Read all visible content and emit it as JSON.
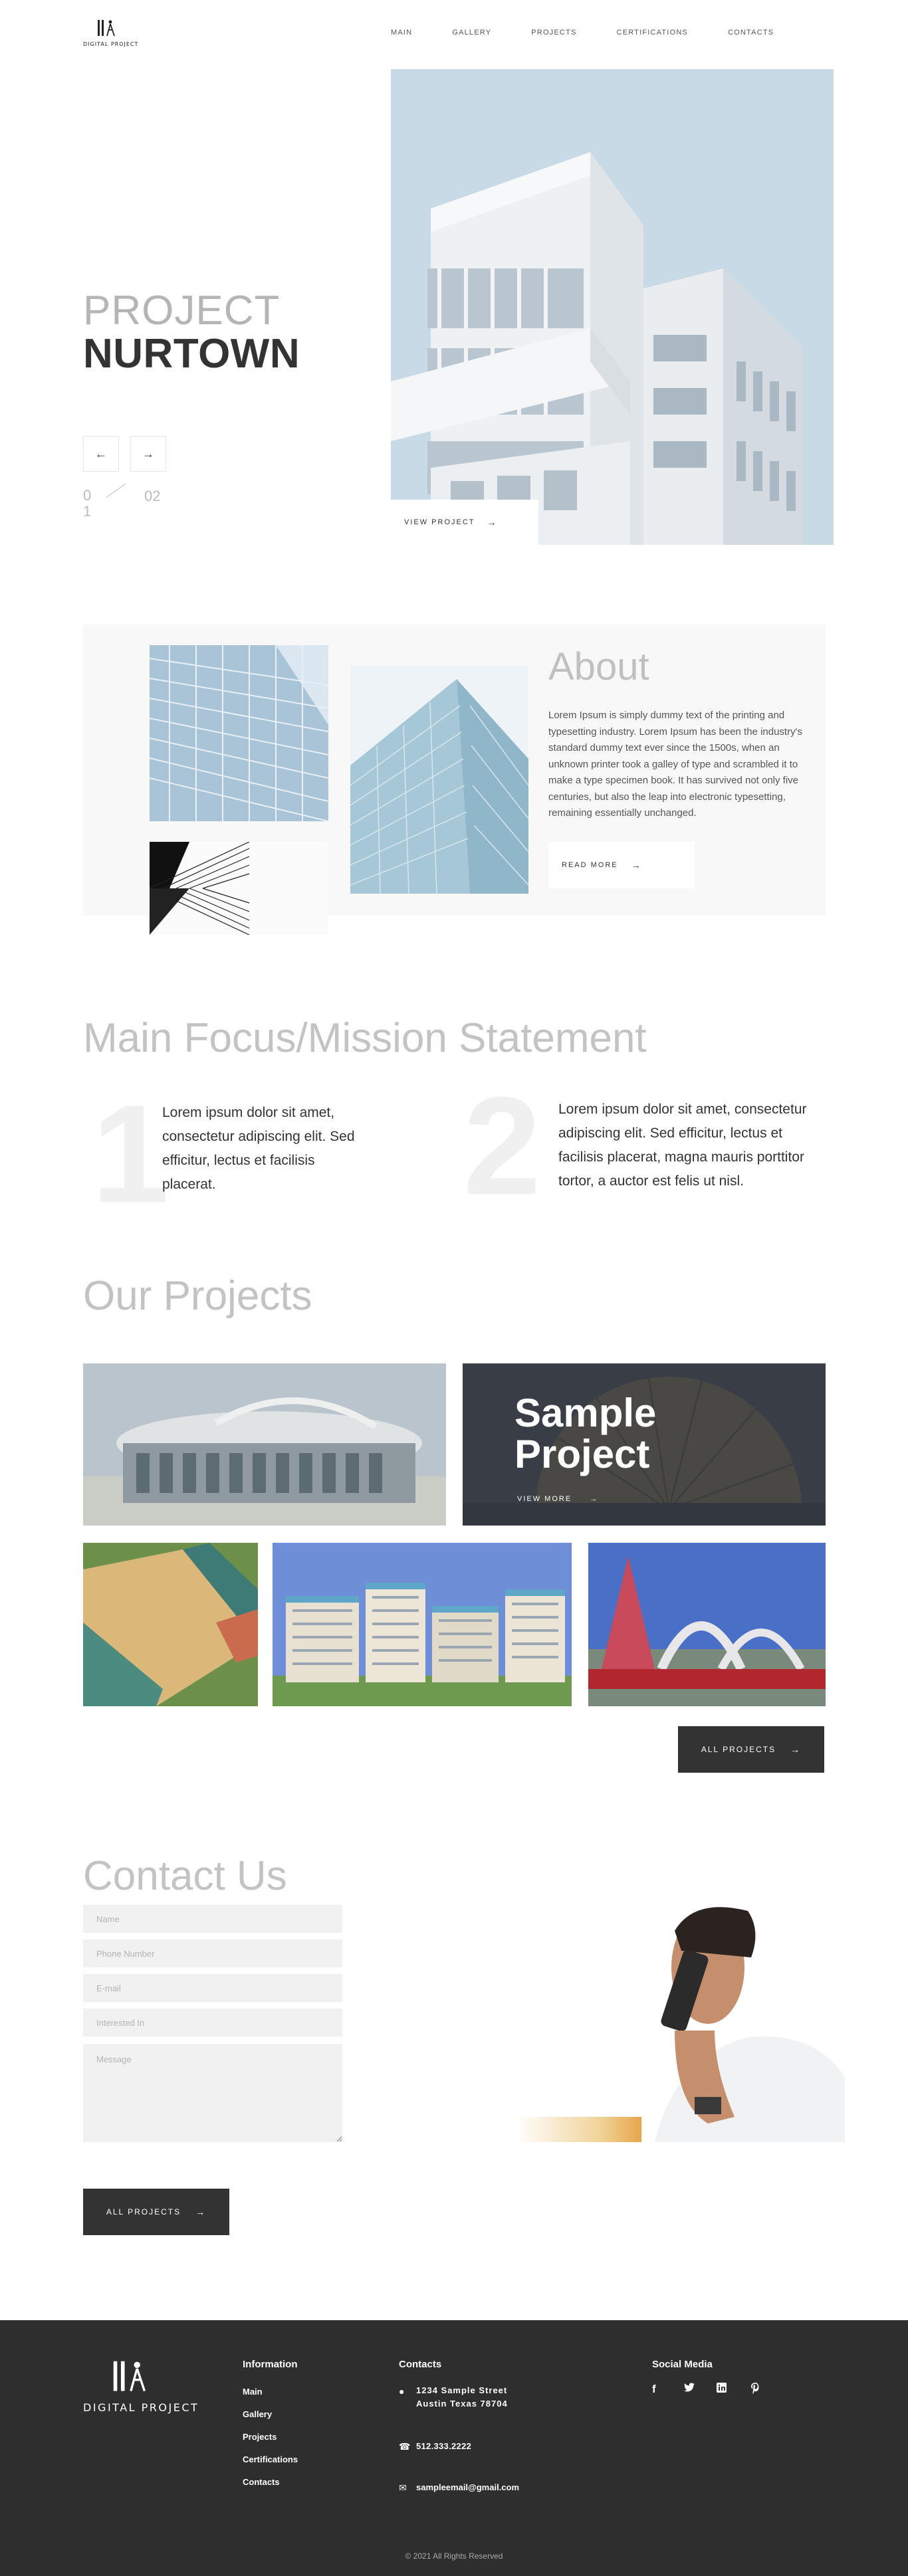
{
  "header": {
    "logo_text": "DIGITAL PROJECT",
    "nav": [
      "MAIN",
      "GALLERY",
      "PROJECTS",
      "CERTIFICATIONS",
      "CONTACTS"
    ]
  },
  "hero": {
    "title_light": "PROJECT",
    "title_bold": "NURTOWN",
    "prev_icon": "arrow-left-icon",
    "next_icon": "arrow-right-icon",
    "pager_current": "0 1",
    "pager_total": "02",
    "view_project_label": "VIEW PROJECT"
  },
  "about": {
    "title": "About",
    "text": "Lorem Ipsum is simply dummy text of the printing and typesetting industry. Lorem Ipsum has been the industry's standard dummy text ever since the 1500s, when an unknown printer took a galley of type and scrambled it to make a type specimen book. It has survived not only five centuries, but also the leap into electronic typesetting, remaining essentially unchanged.",
    "button_label": "READ MORE"
  },
  "mission": {
    "title": "Main Focus/Mission Statement",
    "items": [
      {
        "number": "1",
        "text": "Lorem ipsum dolor sit amet, consectetur adipiscing elit. Sed efficitur, lectus et facilisis placerat."
      },
      {
        "number": "2",
        "text": "Lorem ipsum dolor sit amet, consectetur adipiscing elit. Sed efficitur, lectus et facilisis placerat, magna mauris porttitor tortor, a auctor est felis ut nisl."
      }
    ]
  },
  "projects": {
    "title": "Our Projects",
    "featured_title": "Sample Project",
    "featured_view_label": "VIEW MORE",
    "all_projects_label": "ALL PROJECTS"
  },
  "contact": {
    "title": "Contact Us",
    "placeholders": {
      "name": "Name",
      "phone": "Phone Number",
      "email": "E-mail",
      "interest": "Interested In",
      "message": "Message"
    },
    "button_label": "ALL PROJECTS"
  },
  "footer": {
    "logo_text": "DIGITAL PROJECT",
    "information_heading": "Information",
    "information_links": [
      "Main",
      "Gallery",
      "Projects",
      "Certifications",
      "Contacts"
    ],
    "contacts_heading": "Contacts",
    "address_line1": "1234 Sample Street",
    "address_line2": "Austin Texas 78704",
    "phone": "512.333.2222",
    "email": "sampleemail@gmail.com",
    "social_heading": "Social Media",
    "social_icons": [
      "facebook-icon",
      "twitter-icon",
      "linkedin-icon",
      "pinterest-icon"
    ],
    "copyright": "© 2021 All Rights Reserved"
  },
  "colors": {
    "dark": "#333333",
    "footer_bg": "#2e2e2e",
    "light_title": "#c3c3c3",
    "panel_bg": "#f8f8f8"
  }
}
